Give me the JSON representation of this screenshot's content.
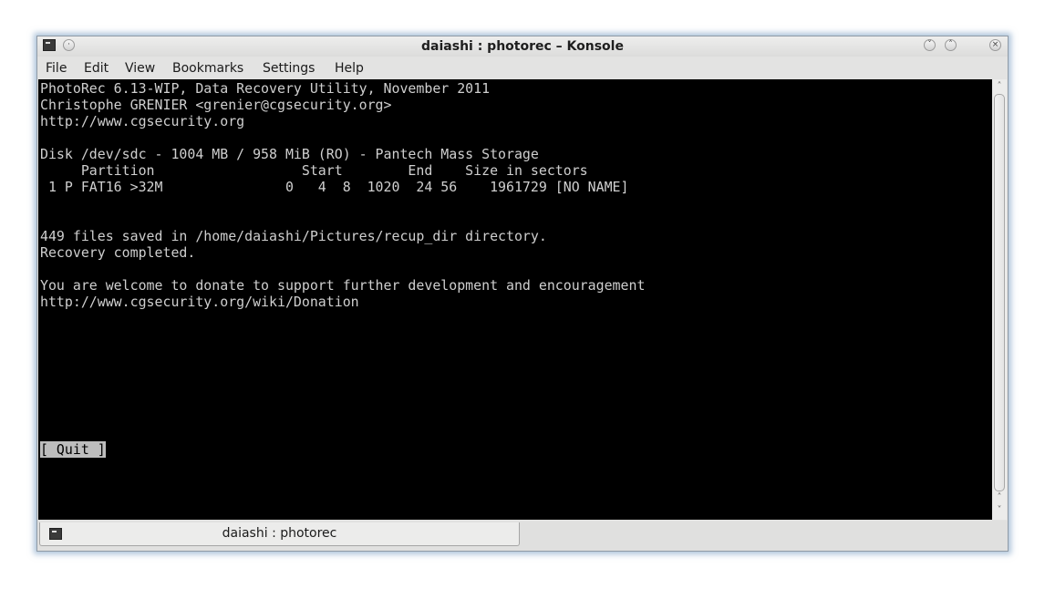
{
  "window": {
    "title": "daiashi : photorec – Konsole"
  },
  "menubar": {
    "items": [
      "File",
      "Edit",
      "View",
      "Bookmarks",
      "Settings",
      "Help"
    ]
  },
  "terminal": {
    "lines": [
      "PhotoRec 6.13-WIP, Data Recovery Utility, November 2011",
      "Christophe GRENIER <grenier@cgsecurity.org>",
      "http://www.cgsecurity.org",
      "",
      "Disk /dev/sdc - 1004 MB / 958 MiB (RO) - Pantech Mass Storage",
      "     Partition                  Start        End    Size in sectors",
      " 1 P FAT16 >32M               0   4  8  1020  24 56    1961729 [NO NAME]",
      "",
      "",
      "449 files saved in /home/daiashi/Pictures/recup_dir directory.",
      "Recovery completed.",
      "",
      "You are welcome to donate to support further development and encouragement",
      "http://www.cgsecurity.org/wiki/Donation"
    ],
    "quit_label": "[ Quit ]"
  },
  "tabbar": {
    "tabs": [
      {
        "label": "daiashi : photorec",
        "icon": "terminal-icon"
      }
    ]
  },
  "icons": {
    "app": "terminal-icon",
    "sticky": "pin-icon",
    "minimize": "chevron-down-icon",
    "maximize": "chevron-up-icon",
    "close": "close-icon"
  },
  "colors": {
    "terminal_bg": "#000000",
    "terminal_fg": "#cfcfcf",
    "selected_button_bg": "#bdbdbd"
  }
}
